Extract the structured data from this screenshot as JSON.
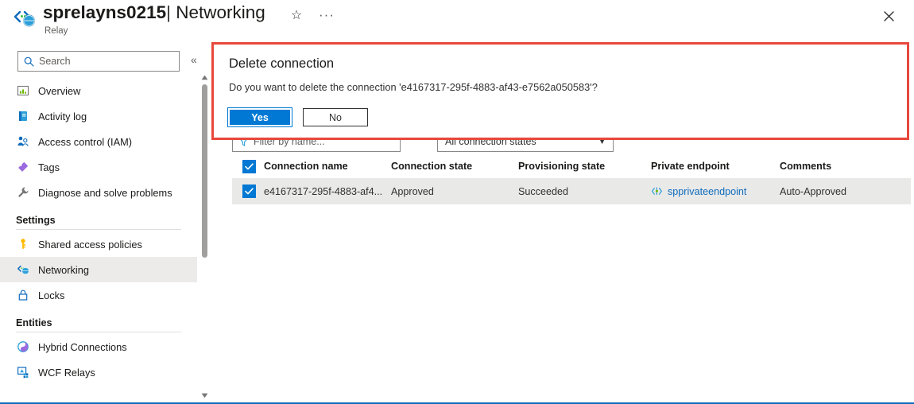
{
  "header": {
    "icon": "relay-resource-icon",
    "resource_name": "sprelayns0215",
    "separator": "|",
    "page": "Networking",
    "subtitle": "Relay",
    "favorite_icon": "star-icon",
    "more_icon": "ellipsis-icon",
    "close_icon": "close-icon"
  },
  "sidebar": {
    "search": {
      "placeholder": "Search",
      "value": "",
      "icon": "search-icon"
    },
    "collapse_icon": "chevron-double-left-icon",
    "items": [
      {
        "label": "Overview",
        "icon": "overview-icon",
        "selected": false
      },
      {
        "label": "Activity log",
        "icon": "activity-log-icon",
        "selected": false
      },
      {
        "label": "Access control (IAM)",
        "icon": "access-control-icon",
        "selected": false
      },
      {
        "label": "Tags",
        "icon": "tags-icon",
        "selected": false
      },
      {
        "label": "Diagnose and solve problems",
        "icon": "diagnose-icon",
        "selected": false
      }
    ],
    "groups": [
      {
        "title": "Settings",
        "items": [
          {
            "label": "Shared access policies",
            "icon": "key-icon",
            "selected": false
          },
          {
            "label": "Networking",
            "icon": "networking-icon",
            "selected": true
          },
          {
            "label": "Locks",
            "icon": "lock-icon",
            "selected": false
          }
        ]
      },
      {
        "title": "Entities",
        "items": [
          {
            "label": "Hybrid Connections",
            "icon": "hybrid-connections-icon",
            "selected": false
          },
          {
            "label": "WCF Relays",
            "icon": "wcf-relays-icon",
            "selected": false
          }
        ]
      }
    ],
    "scrollbar": {
      "up_icon": "scroll-up-arrow-icon",
      "down_icon": "scroll-down-arrow-icon"
    }
  },
  "main": {
    "filters": {
      "name_filter": {
        "placeholder": "Filter by name...",
        "value": "",
        "icon": "filter-icon"
      },
      "state_filter": {
        "value": "All connection states",
        "icon": "chevron-down-icon"
      }
    },
    "table": {
      "select_all_icon": "checkbox-checked-icon",
      "columns": [
        "Connection name",
        "Connection state",
        "Provisioning state",
        "Private endpoint",
        "Comments"
      ],
      "rows": [
        {
          "selected": true,
          "checkbox_icon": "checkbox-checked-icon",
          "connection_name": "e4167317-295f-4883-af4...",
          "connection_state": "Approved",
          "provisioning_state": "Succeeded",
          "private_endpoint": "spprivateendpoint",
          "private_endpoint_icon": "private-endpoint-icon",
          "comments": "Auto-Approved"
        }
      ]
    }
  },
  "dialog": {
    "title": "Delete connection",
    "message": "Do you want to delete the connection 'e4167317-295f-4883-af43-e7562a050583'?",
    "confirm_label": "Yes",
    "cancel_label": "No",
    "border_color": "#e8483c",
    "accent_color": "#0078d4"
  }
}
